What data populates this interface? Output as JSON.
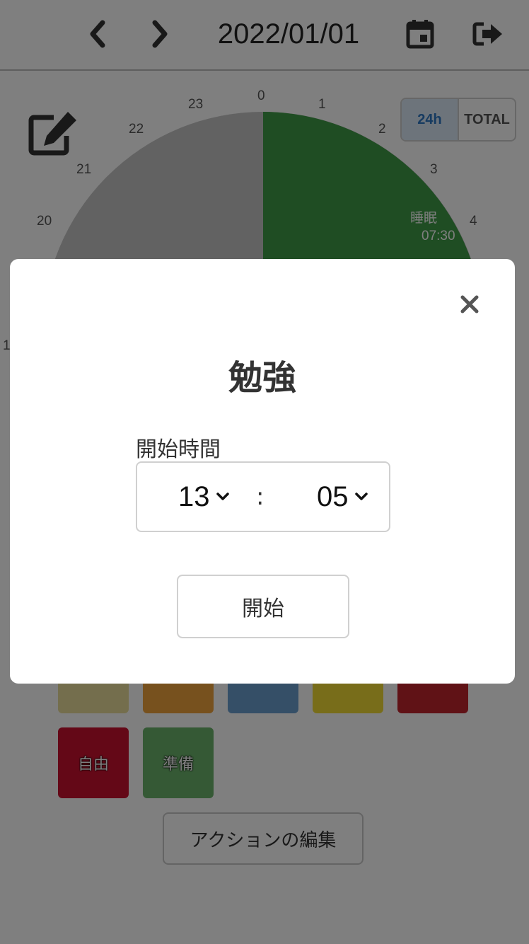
{
  "header": {
    "date": "2022/01/01",
    "prev_icon": "chevron-left-icon",
    "next_icon": "chevron-right-icon",
    "calendar_icon": "calendar-icon",
    "logout_icon": "logout-icon"
  },
  "clock": {
    "hour_labels": [
      "0",
      "1",
      "2",
      "3",
      "4",
      "20",
      "21",
      "22",
      "23",
      "1"
    ],
    "segment": {
      "name": "睡眠",
      "duration": "07:30",
      "color": "#3f9b47"
    },
    "background_color": "#c4c4c4",
    "edit_icon": "edit-icon"
  },
  "toggle": {
    "day": "24h",
    "total": "TOTAL"
  },
  "actions": {
    "row1_colors": [
      "#e8dd9b",
      "#efa23c",
      "#6a9fcf",
      "#f0da35",
      "#c0242c"
    ],
    "row2": [
      {
        "label": "自由",
        "color": "#c8102f"
      },
      {
        "label": "準備",
        "color": "#6ab26a"
      }
    ],
    "edit_label": "アクションの編集"
  },
  "modal": {
    "title": "勉強",
    "close_icon": "close-icon",
    "field_label": "開始時間",
    "hour": "13",
    "minute": "05",
    "separator": ":",
    "start_label": "開始"
  }
}
